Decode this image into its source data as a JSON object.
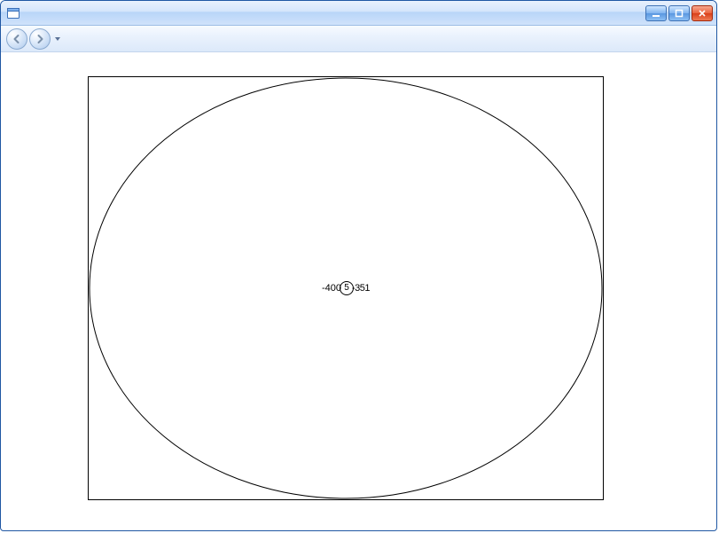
{
  "window": {
    "title": ""
  },
  "center": {
    "left_text": "-400",
    "circle_text": "5",
    "right_text": "-351"
  }
}
